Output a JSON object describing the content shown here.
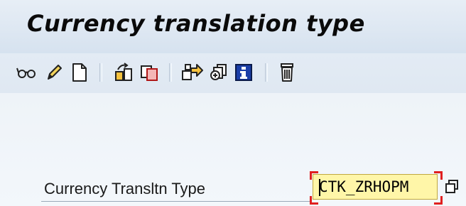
{
  "window": {
    "title": "Currency translation type"
  },
  "toolbar": {
    "buttons": [
      {
        "icon": "glasses-icon"
      },
      {
        "icon": "pencil-icon"
      },
      {
        "icon": "new-document-icon"
      },
      {
        "icon": "other-object-icon"
      },
      {
        "icon": "copy-icon"
      },
      {
        "icon": "transport-icon"
      },
      {
        "icon": "where-used-icon"
      },
      {
        "icon": "information-icon"
      },
      {
        "icon": "delete-icon"
      }
    ]
  },
  "form": {
    "field_label": "Currency Transltn Type",
    "field_value": "CTK_ZRHOPM"
  },
  "colors": {
    "field_bg": "#fff6a8",
    "focus_corner": "#e02020",
    "info_blue": "#1a3ea8"
  }
}
